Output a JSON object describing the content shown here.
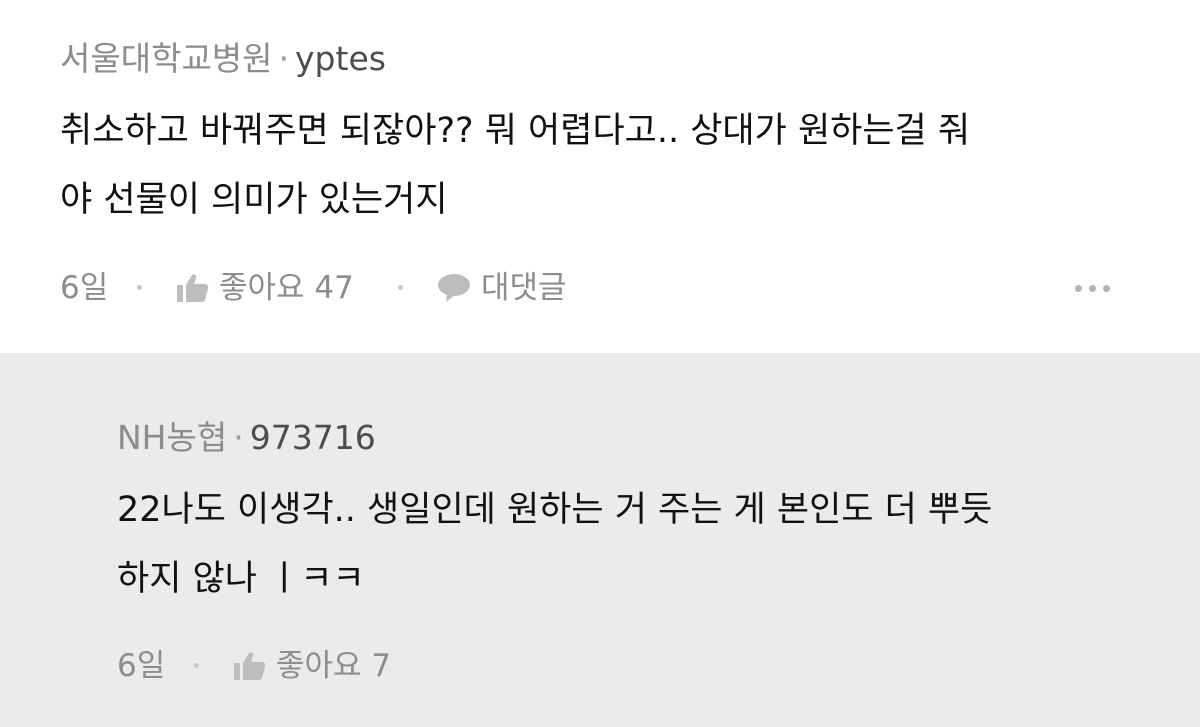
{
  "comment": {
    "author": "서울대학교병원",
    "separator": "·",
    "user_id": "yptes",
    "text_line1": "취소하고 바꿔주면 되잖아?? 뭐 어렵다고.. 상대가 원하는걸 줘",
    "text_line2": "야 선물이 의미가 있는거지",
    "age": "6일",
    "like_label": "좋아요 47",
    "reply_label": "대댓글",
    "icons": [
      "thumbs-up-icon",
      "speech-bubble-icon",
      "more-dots-icon"
    ]
  },
  "reply": {
    "author": "NH농협",
    "separator": "·",
    "user_id": "973716",
    "text_line1": "22나도 이생각.. 생일인데 원하는 거 주는 게 본인도 더 뿌듯",
    "text_line2": "하지 않나 ㅣㅋㅋ",
    "age": "6일",
    "like_label": "좋아요 7",
    "icons": [
      "thumbs-up-icon"
    ]
  },
  "colors": {
    "reply_background": "#ebebed",
    "meta_text": "#8c8c8c",
    "body_text": "#111111"
  }
}
